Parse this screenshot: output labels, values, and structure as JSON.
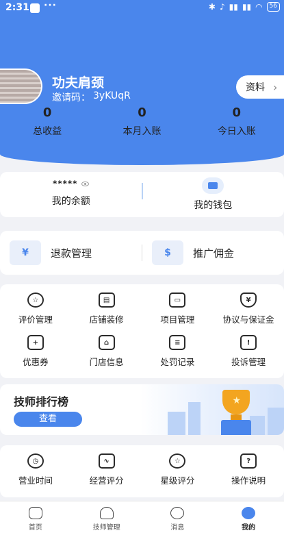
{
  "status_bar": {
    "time": "2:31",
    "more": "···",
    "battery": "56"
  },
  "profile": {
    "shop_name": "功夫肩颈",
    "invite_label": "邀请码：",
    "invite_code": "3yKUqR",
    "profile_button": "资料",
    "profile_chevron": "›"
  },
  "stats": [
    {
      "value": "0",
      "label": "总收益"
    },
    {
      "value": "0",
      "label": "本月入账"
    },
    {
      "value": "0",
      "label": "今日入账"
    }
  ],
  "wallet": {
    "balance_masked": "*****",
    "balance_label": "我的余额",
    "wallet_label": "我的钱包"
  },
  "quick_actions": [
    {
      "label": "退款管理",
      "icon": "refund-icon",
      "glyph": "¥"
    },
    {
      "label": "推广佣金",
      "icon": "money-bag-icon",
      "glyph": "$"
    }
  ],
  "services": [
    {
      "label": "评价管理",
      "icon": "review-icon",
      "glyph": "☆"
    },
    {
      "label": "店铺装修",
      "icon": "paint-roller-icon",
      "glyph": "▤"
    },
    {
      "label": "项目管理",
      "icon": "folder-icon",
      "glyph": "▭"
    },
    {
      "label": "协议与保证金",
      "icon": "shield-yen-icon",
      "glyph": "¥"
    },
    {
      "label": "优惠券",
      "icon": "coupon-icon",
      "glyph": "+"
    },
    {
      "label": "门店信息",
      "icon": "store-icon",
      "glyph": "⌂"
    },
    {
      "label": "处罚记录",
      "icon": "penalty-record-icon",
      "glyph": "≡"
    },
    {
      "label": "投诉管理",
      "icon": "complaint-icon",
      "glyph": "!"
    }
  ],
  "ranking": {
    "title": "技师排行榜",
    "button": "查看",
    "trophy_star": "★"
  },
  "tools": [
    {
      "label": "营业时间",
      "icon": "clock-icon",
      "glyph": "◷"
    },
    {
      "label": "经营评分",
      "icon": "chart-icon",
      "glyph": "∿"
    },
    {
      "label": "星级评分",
      "icon": "star-icon",
      "glyph": "☆"
    },
    {
      "label": "操作说明",
      "icon": "document-icon",
      "glyph": "?"
    }
  ],
  "tabbar": [
    {
      "label": "首页",
      "icon": "home-icon"
    },
    {
      "label": "技师管理",
      "icon": "technician-icon"
    },
    {
      "label": "消息",
      "icon": "message-icon"
    },
    {
      "label": "我的",
      "icon": "profile-icon"
    }
  ],
  "colors": {
    "primary": "#4a86ec",
    "background": "#f1f2f6",
    "trophy": "#f3a520"
  }
}
